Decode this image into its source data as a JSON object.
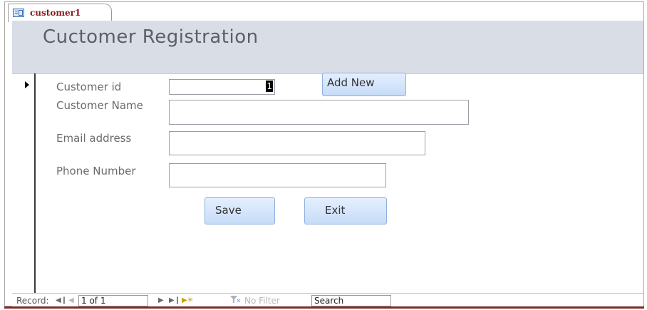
{
  "tab": {
    "icon": "form-icon",
    "label": "customer1"
  },
  "header": {
    "title": "Cuctomer Registration"
  },
  "form": {
    "customer_id": {
      "label": "Customer id",
      "value": "1"
    },
    "customer_name": {
      "label": "Customer Name",
      "value": ""
    },
    "email": {
      "label": "Email address",
      "value": ""
    },
    "phone": {
      "label": "Phone Number",
      "value": ""
    },
    "add_new_label": "Add New",
    "save_label": "Save",
    "exit_label": "Exit"
  },
  "navbar": {
    "record_label": "Record:",
    "first_icon": "first-record-icon",
    "prev_icon": "previous-record-icon",
    "position": "1 of 1",
    "next_icon": "next-record-icon",
    "last_icon": "last-record-icon",
    "new_icon": "new-record-icon",
    "filter_label": "No Filter",
    "search_label": "Search"
  },
  "colors": {
    "header_bg": "#d8dde6",
    "button_bg": "#c7dcf7",
    "tab_label": "#8b1a1a",
    "bottom_rule": "#7e2b25"
  }
}
